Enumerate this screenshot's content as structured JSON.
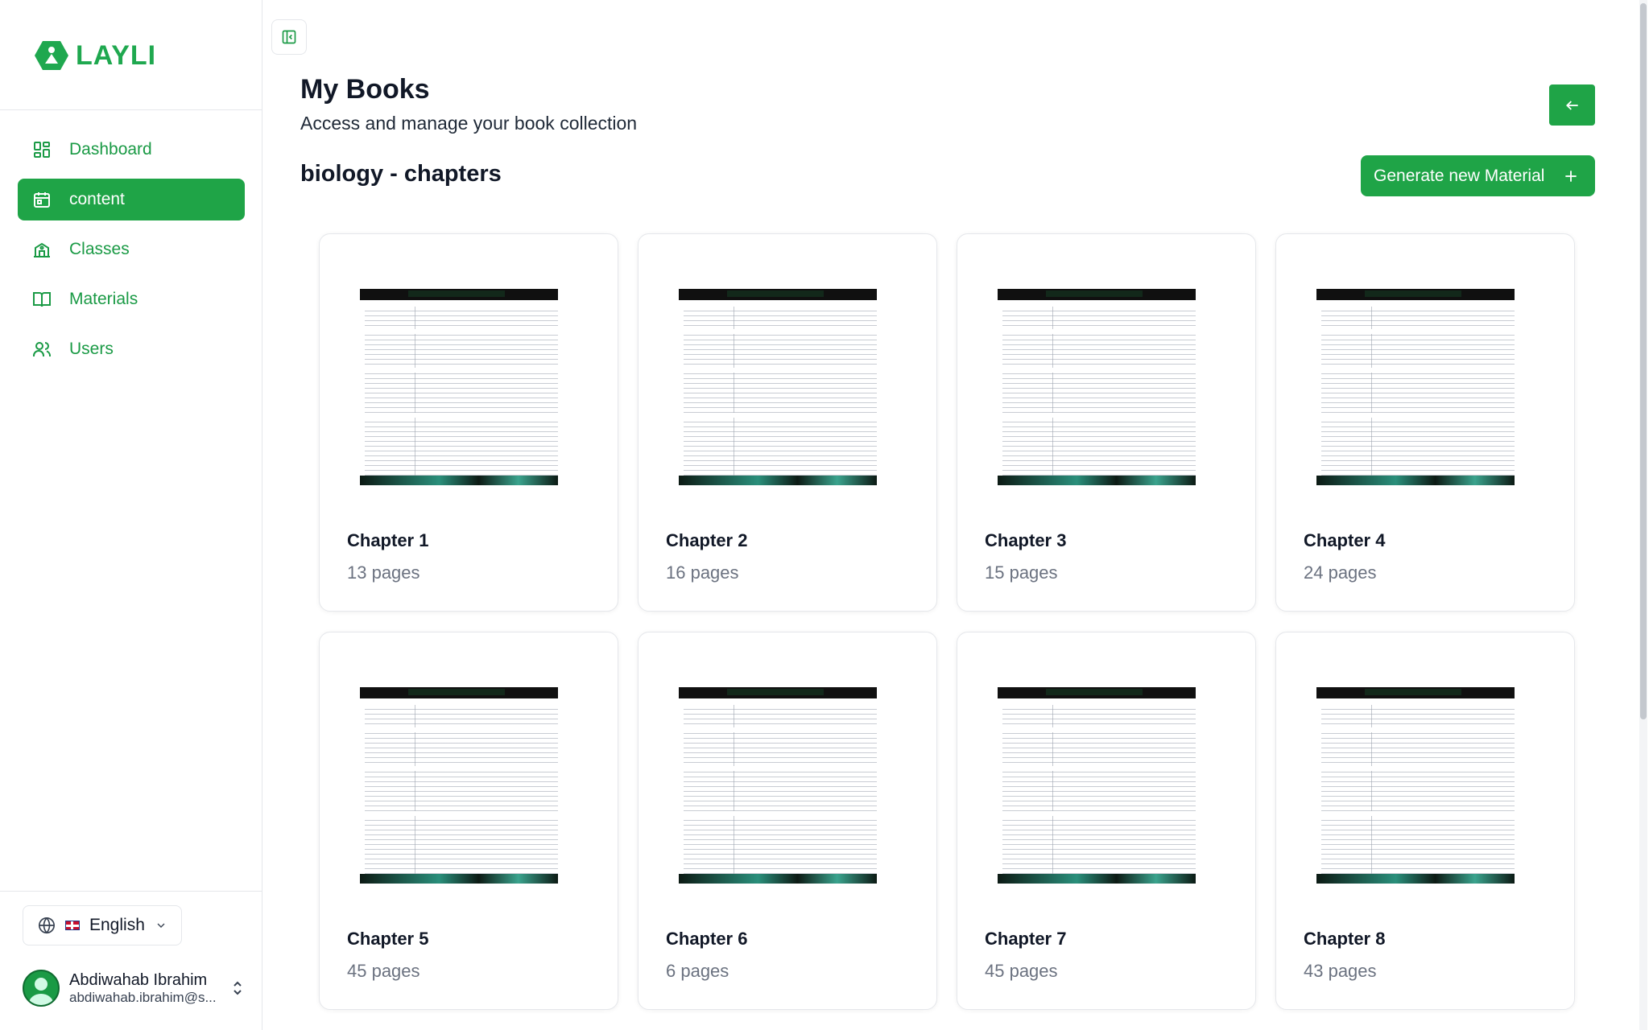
{
  "app": {
    "logo_text": "LAYLI"
  },
  "sidebar": {
    "items": [
      {
        "label": "Dashboard",
        "icon": "dashboard-icon",
        "active": false
      },
      {
        "label": "content",
        "icon": "calendar-icon",
        "active": true
      },
      {
        "label": "Classes",
        "icon": "school-icon",
        "active": false
      },
      {
        "label": "Materials",
        "icon": "book-icon",
        "active": false
      },
      {
        "label": "Users",
        "icon": "users-icon",
        "active": false
      }
    ],
    "language": {
      "label": "English"
    },
    "user": {
      "name": "Abdiwahab Ibrahim",
      "email": "abdiwahab.ibrahim@s..."
    }
  },
  "header": {
    "title": "My Books",
    "subtitle": "Access and manage your book collection",
    "section_title": "biology - chapters",
    "generate_label": "Generate new Material"
  },
  "books": [
    {
      "title": "Chapter 1",
      "pages": "13 pages"
    },
    {
      "title": "Chapter 2",
      "pages": "16 pages"
    },
    {
      "title": "Chapter 3",
      "pages": "15 pages"
    },
    {
      "title": "Chapter 4",
      "pages": "24 pages"
    },
    {
      "title": "Chapter 5",
      "pages": "45 pages"
    },
    {
      "title": "Chapter 6",
      "pages": "6 pages"
    },
    {
      "title": "Chapter 7",
      "pages": "45 pages"
    },
    {
      "title": "Chapter 8",
      "pages": "43 pages"
    }
  ],
  "colors": {
    "accent": "#1fa447",
    "accent_text": "#1a9a45"
  }
}
